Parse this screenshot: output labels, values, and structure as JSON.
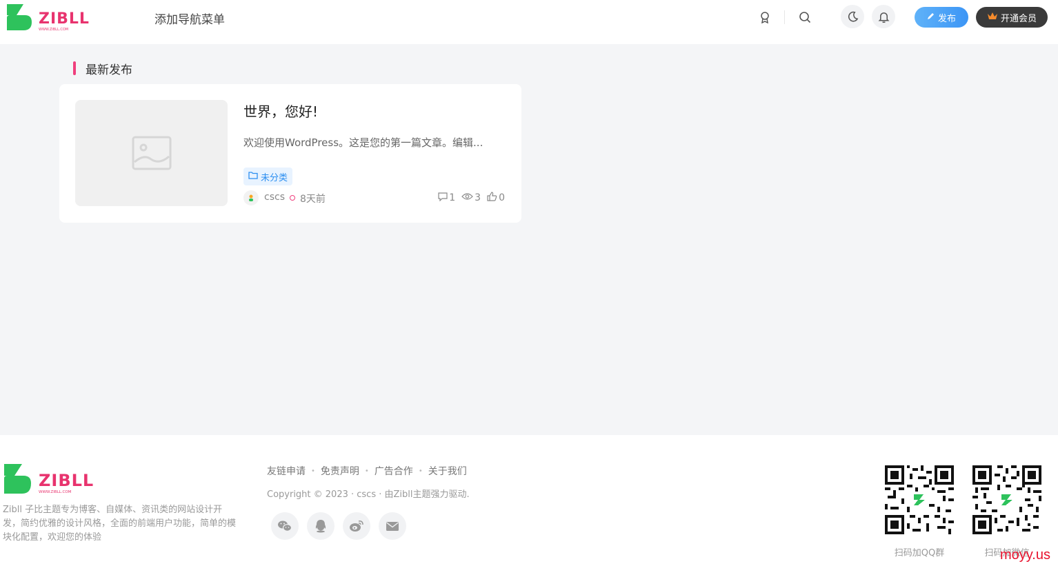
{
  "header": {
    "logo_text": "ZIBLL",
    "logo_subtext": "WWW.ZIBLL.COM",
    "nav_add_menu": "添加导航菜单",
    "publish_label": "发布",
    "vip_label": "开通会员"
  },
  "section": {
    "title": "最新发布"
  },
  "post": {
    "title": "世界，您好!",
    "excerpt": "欢迎使用WordPress。这是您的第一篇文章。编辑...",
    "category": "未分类",
    "author": "cscs",
    "time": "8天前",
    "comments": "1",
    "views": "3",
    "likes": "0"
  },
  "footer": {
    "logo_text": "ZIBLL",
    "logo_subtext": "WWW.ZIBLL.COM",
    "description": "Zibll 子比主题专为博客、自媒体、资讯类的网站设计开发，简约优雅的设计风格，全面的前端用户功能，简单的模块化配置，欢迎您的体验",
    "links": [
      "友链申请",
      "免责声明",
      "广告合作",
      "关于我们"
    ],
    "copyright": "Copyright © 2023 · cscs · 由Zibll主题强力驱动.",
    "qr": [
      {
        "label": "扫码加QQ群"
      },
      {
        "label": "扫码加微信"
      }
    ]
  },
  "watermark": "moyy.us",
  "colors": {
    "accent": "#ef3f7d",
    "brand_green": "#2ec25c",
    "brand_pink": "#e8336e",
    "publish_blue": "#3c95f5"
  }
}
